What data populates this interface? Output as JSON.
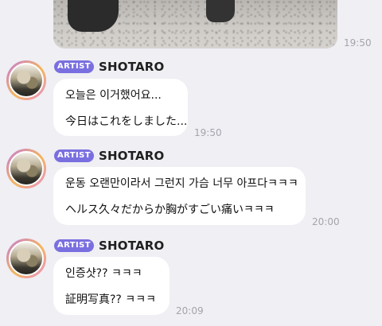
{
  "top_message": {
    "type": "photo",
    "time": "19:50"
  },
  "messages": [
    {
      "badge": "ARTIST",
      "sender": "SHOTARO",
      "lines": [
        "오늘은 이거했어요...",
        "今日はこれをしました..."
      ],
      "time": "19:50"
    },
    {
      "badge": "ARTIST",
      "sender": "SHOTARO",
      "lines": [
        "운동 오랜만이라서 그런지 가슴 너무 아프다ㅋㅋㅋ",
        "ヘルス久々だからか胸がすごい痛いㅋㅋㅋ"
      ],
      "time": "20:00"
    },
    {
      "badge": "ARTIST",
      "sender": "SHOTARO",
      "lines": [
        "인증샷?? ㅋㅋㅋ",
        "証明写真?? ㅋㅋㅋ"
      ],
      "time": "20:09"
    }
  ],
  "colors": {
    "background": "#efeff4",
    "bubble": "#ffffff",
    "artist_badge": "#7a6fe0",
    "timestamp": "#a4a4ab"
  }
}
